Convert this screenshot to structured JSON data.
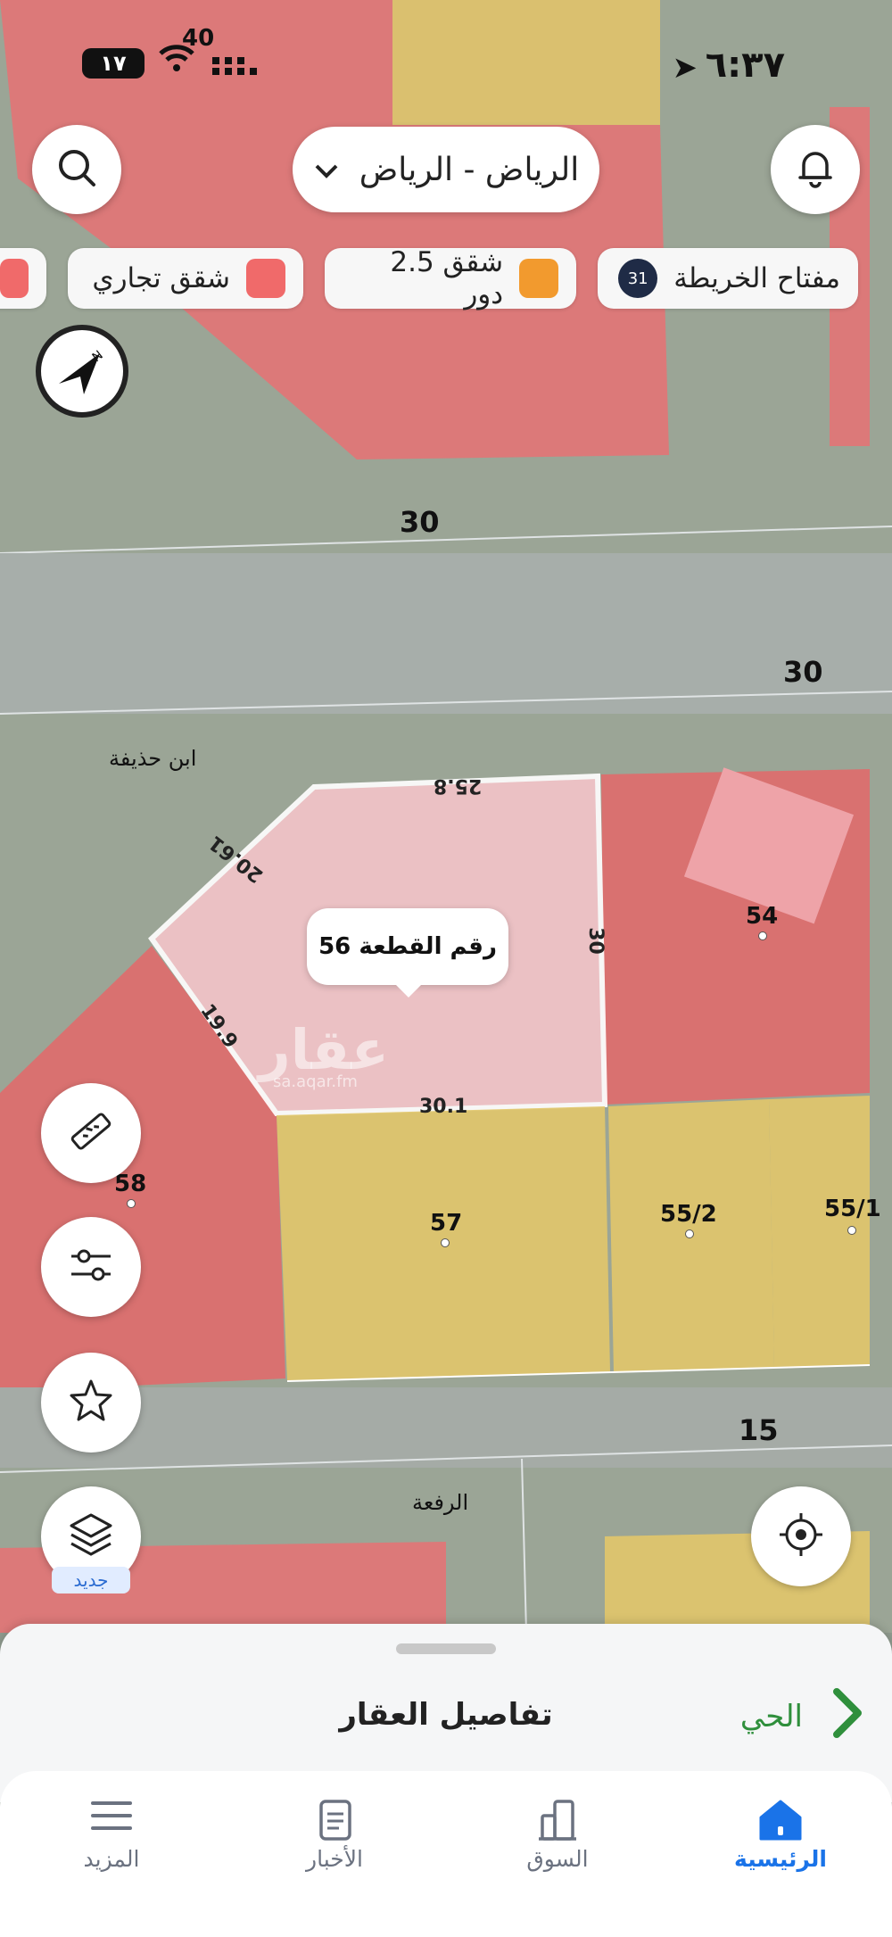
{
  "status_bar": {
    "time": "٦:٣٧",
    "battery": "١٧",
    "signal": "40"
  },
  "header": {
    "city": "الرياض - الرياض"
  },
  "legend_chips": [
    {
      "label": "مفتاح الخريطة",
      "count": "31",
      "color": "#1f2b46"
    },
    {
      "label": "شقق 2.5 دور",
      "color": "#f29a2e"
    },
    {
      "label": "شقق تجاري",
      "color": "#f06a6a"
    }
  ],
  "map": {
    "street_labels": [
      "30",
      "30",
      "15"
    ],
    "neighborhood_labels": [
      "ابن حذيفة",
      "الرفعة"
    ],
    "plot_numbers": [
      "54",
      "58",
      "57",
      "55/2",
      "55/1"
    ],
    "dimensions": [
      "25.8",
      "20.61",
      "30",
      "19.9",
      "30.1"
    ],
    "tooltip": "رقم القطعة 56",
    "watermark": "عقار",
    "watermark_sub": "sa.aqar.fm",
    "colors": {
      "commercial": "#e06b6b",
      "residential": "#e2c66a",
      "selected": "#f2c4c8"
    }
  },
  "side_controls": {
    "new_badge": "جديد"
  },
  "sheet": {
    "title": "تفاصيل العقار",
    "neighborhood": "الحي"
  },
  "tabs": [
    {
      "label": "الرئيسية",
      "active": true
    },
    {
      "label": "السوق",
      "active": false
    },
    {
      "label": "الأخبار",
      "active": false
    },
    {
      "label": "المزيد",
      "active": false
    }
  ]
}
